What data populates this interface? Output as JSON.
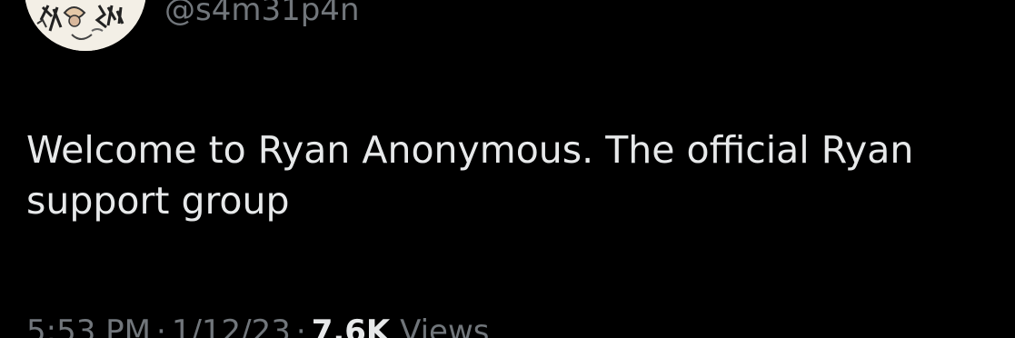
{
  "tweet": {
    "handle": "@s4m31p4n",
    "text_line_1": "Welcome to Ryan Anonymous. The official Ryan",
    "text_line_2": "support group",
    "time": "5:53 PM",
    "date": "1/12/23",
    "separator": "·",
    "views_count": "7.6K",
    "views_label": "Views"
  },
  "avatar": {
    "icon": "profile-avatar-doodle-icon"
  },
  "colors": {
    "background": "#000000",
    "primary_text": "#e7e9ea",
    "secondary_text": "#71767b"
  }
}
